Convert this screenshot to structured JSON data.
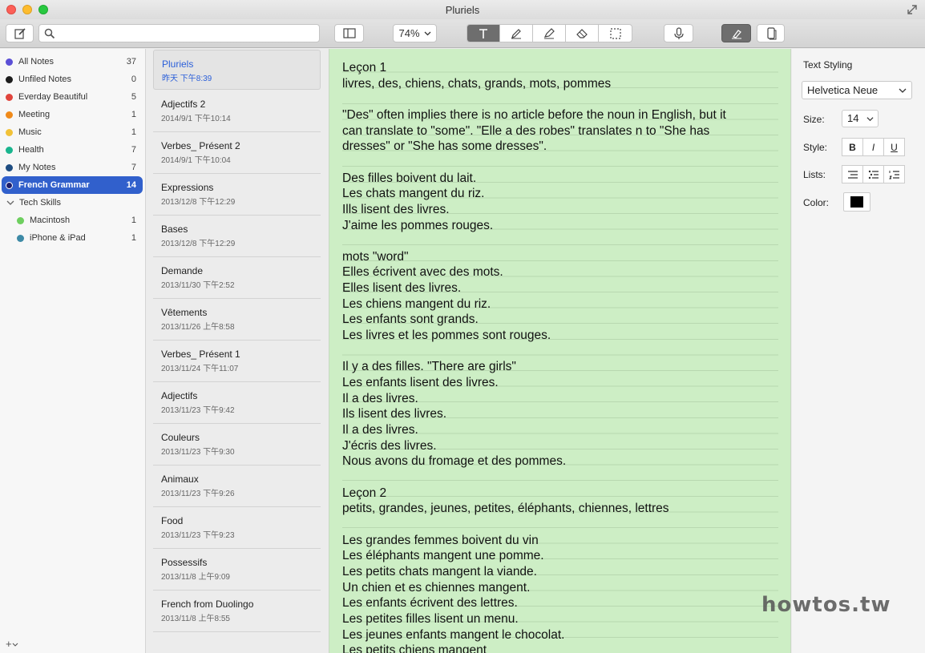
{
  "window": {
    "title": "Pluriels"
  },
  "toolbar": {
    "search_placeholder": "",
    "zoom": "74%"
  },
  "sidebar": {
    "folders": [
      {
        "name": "All Notes",
        "count": "37",
        "color": "#5b4fd6"
      },
      {
        "name": "Unfiled Notes",
        "count": "0",
        "color": "#1d1d1d"
      },
      {
        "name": "Everday Beautiful",
        "count": "5",
        "color": "#e0443c"
      },
      {
        "name": "Meeting",
        "count": "1",
        "color": "#f08a1a"
      },
      {
        "name": "Music",
        "count": "1",
        "color": "#f2c238"
      },
      {
        "name": "Health",
        "count": "7",
        "color": "#19b58e"
      },
      {
        "name": "My Notes",
        "count": "7",
        "color": "#1f4d82"
      },
      {
        "name": "French Grammar",
        "count": "14",
        "color": "#1d1d6b"
      }
    ],
    "group": {
      "name": "Tech Skills"
    },
    "subfolders": [
      {
        "name": "Macintosh",
        "count": "1",
        "color": "#6ecf5f"
      },
      {
        "name": "iPhone & iPad",
        "count": "1",
        "color": "#3d8aa6"
      }
    ],
    "add_label": "+"
  },
  "notes": [
    {
      "title": "Pluriels",
      "date": "昨天 下午8:39"
    },
    {
      "title": "Adjectifs 2",
      "date": "2014/9/1 下午10:14"
    },
    {
      "title": "Verbes_ Présent 2",
      "date": "2014/9/1 下午10:04"
    },
    {
      "title": "Expressions",
      "date": "2013/12/8 下午12:29"
    },
    {
      "title": "Bases",
      "date": "2013/12/8 下午12:29"
    },
    {
      "title": "Demande",
      "date": "2013/11/30 下午2:52"
    },
    {
      "title": "Vêtements",
      "date": "2013/11/26 上午8:58"
    },
    {
      "title": "Verbes_ Présent 1",
      "date": "2013/11/24 下午11:07"
    },
    {
      "title": "Adjectifs",
      "date": "2013/11/23 下午9:42"
    },
    {
      "title": "Couleurs",
      "date": "2013/11/23 下午9:30"
    },
    {
      "title": "Animaux",
      "date": "2013/11/23 下午9:26"
    },
    {
      "title": "Food",
      "date": "2013/11/23 下午9:23"
    },
    {
      "title": "Possessifs",
      "date": "2013/11/8 上午9:09"
    },
    {
      "title": "French from Duolingo",
      "date": "2013/11/8 上午8:55"
    }
  ],
  "editor": {
    "lines": [
      "Leçon 1",
      "livres, des, chiens, chats, grands, mots, pommes",
      "",
      "\"Des\" often implies there is no article before the noun in English, but it",
      "can translate to \"some\". \"Elle a des robes\" translates n to \"She has",
      "dresses\" or \"She has some dresses\".",
      "",
      "Des filles boivent du lait.",
      "Les chats mangent du riz.",
      "Ills lisent des livres.",
      "J'aime les pommes rouges.",
      "",
      "mots \"word\"",
      "Elles écrivent avec des mots.",
      "Elles lisent des livres.",
      "Les chiens mangent du riz.",
      "Les enfants sont grands.",
      "Les livres et les pommes sont rouges.",
      "",
      "Il y a des filles. \"There are girls\"",
      "Les enfants lisent des livres.",
      "Il a des livres.",
      "Ils lisent des livres.",
      "Il a des livres.",
      "J'écris des livres.",
      "Nous avons du fromage et des pommes.",
      "",
      "Leçon 2",
      "petits, grandes, jeunes, petites, éléphants, chiennes, lettres",
      "",
      "Les grandes femmes boivent du vin",
      "Les éléphants mangent une pomme.",
      "Les petits chats mangent la viande.",
      "Un chien et es chiennes mangent.",
      "Les enfants écrivent des lettres.",
      "Les petites filles lisent un menu.",
      "Les jeunes enfants mangent le chocolat.",
      "Les petits chiens mangent"
    ],
    "background": "#cdeec5"
  },
  "inspector": {
    "title": "Text Styling",
    "font": "Helvetica Neue",
    "size_label": "Size:",
    "size": "14",
    "style_label": "Style:",
    "bold": "B",
    "italic": "I",
    "underline": "U",
    "lists_label": "Lists:",
    "color_label": "Color:",
    "color": "#000000"
  },
  "watermark": "howtos.tw"
}
